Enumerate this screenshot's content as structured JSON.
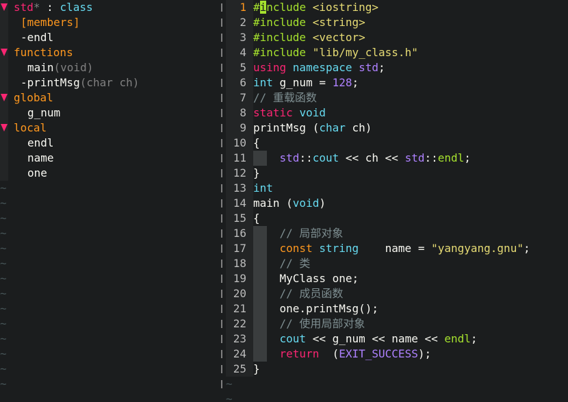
{
  "colors": {
    "background": "#1b1d1e",
    "accent_pink": "#f92672",
    "accent_green": "#a6e22e",
    "accent_orange": "#fd971f",
    "accent_purple": "#ae81ff",
    "accent_cyan": "#66d9ef",
    "comment_gray": "#7e8e91"
  },
  "tagbar": {
    "rows": [
      {
        "fold": true,
        "parts": [
          {
            "t": "std",
            "c": "c-red"
          },
          {
            "t": "* ",
            "c": "c-dim"
          },
          {
            "t": ": ",
            "c": "c-plain"
          },
          {
            "t": "class",
            "c": "c-type"
          }
        ]
      },
      {
        "fold": false,
        "indent": 1,
        "parts": [
          {
            "t": "[members]",
            "c": "c-orange"
          }
        ]
      },
      {
        "fold": false,
        "indent": 1,
        "parts": [
          {
            "t": "-endl",
            "c": "c-plain"
          }
        ]
      },
      {
        "fold": true,
        "parts": [
          {
            "t": "functions",
            "c": "c-orange"
          }
        ]
      },
      {
        "fold": false,
        "indent": 2,
        "parts": [
          {
            "t": "main",
            "c": "c-plain"
          },
          {
            "t": "(void)",
            "c": "c-dim"
          }
        ]
      },
      {
        "fold": false,
        "indent": 1,
        "parts": [
          {
            "t": "-printMsg",
            "c": "c-plain"
          },
          {
            "t": "(char ch)",
            "c": "c-dim"
          }
        ]
      },
      {
        "fold": true,
        "parts": [
          {
            "t": "global",
            "c": "c-orange"
          }
        ]
      },
      {
        "fold": false,
        "indent": 2,
        "parts": [
          {
            "t": "g_num",
            "c": "c-plain"
          }
        ]
      },
      {
        "fold": true,
        "parts": [
          {
            "t": "local",
            "c": "c-orange"
          }
        ]
      },
      {
        "fold": false,
        "indent": 2,
        "parts": [
          {
            "t": "endl",
            "c": "c-plain"
          }
        ]
      },
      {
        "fold": false,
        "indent": 2,
        "parts": [
          {
            "t": "name",
            "c": "c-plain"
          }
        ]
      },
      {
        "fold": false,
        "indent": 2,
        "parts": [
          {
            "t": "one",
            "c": "c-plain"
          }
        ]
      }
    ],
    "tilde_count": 14,
    "tilde_char": "~"
  },
  "editor": {
    "current_line": 1,
    "lines": [
      {
        "n": "1",
        "guide": false,
        "parts": [
          {
            "t": "#",
            "c": "c-pre"
          },
          {
            "t": "i",
            "c": "c-cursor"
          },
          {
            "t": "nclude ",
            "c": "c-pre"
          },
          {
            "t": "<iostring>",
            "c": "c-str"
          }
        ]
      },
      {
        "n": "2",
        "guide": false,
        "parts": [
          {
            "t": "#include ",
            "c": "c-pre"
          },
          {
            "t": "<string>",
            "c": "c-str"
          }
        ]
      },
      {
        "n": "3",
        "guide": false,
        "parts": [
          {
            "t": "#include ",
            "c": "c-pre"
          },
          {
            "t": "<vector>",
            "c": "c-str"
          }
        ]
      },
      {
        "n": "4",
        "guide": false,
        "parts": [
          {
            "t": "#include ",
            "c": "c-pre"
          },
          {
            "t": "\"lib/my_class.h\"",
            "c": "c-str"
          }
        ]
      },
      {
        "n": "5",
        "guide": false,
        "parts": [
          {
            "t": "using ",
            "c": "c-kw"
          },
          {
            "t": "namespace ",
            "c": "c-type"
          },
          {
            "t": "std",
            "c": "c-std"
          },
          {
            "t": ";",
            "c": "c-plain"
          }
        ]
      },
      {
        "n": "6",
        "guide": false,
        "parts": [
          {
            "t": "int ",
            "c": "c-type"
          },
          {
            "t": "g_num = ",
            "c": "c-plain"
          },
          {
            "t": "128",
            "c": "c-num"
          },
          {
            "t": ";",
            "c": "c-plain"
          }
        ]
      },
      {
        "n": "7",
        "guide": false,
        "parts": [
          {
            "t": "// 重载函数",
            "c": "c-com"
          }
        ]
      },
      {
        "n": "8",
        "guide": false,
        "parts": [
          {
            "t": "static ",
            "c": "c-kw"
          },
          {
            "t": "void",
            "c": "c-type"
          }
        ]
      },
      {
        "n": "9",
        "guide": false,
        "parts": [
          {
            "t": "printMsg (",
            "c": "c-plain"
          },
          {
            "t": "char ",
            "c": "c-type"
          },
          {
            "t": "ch)",
            "c": "c-plain"
          }
        ]
      },
      {
        "n": "10",
        "guide": false,
        "parts": [
          {
            "t": "{",
            "c": "c-plain"
          }
        ]
      },
      {
        "n": "11",
        "guide": true,
        "parts": [
          {
            "t": "    ",
            "c": "c-plain"
          },
          {
            "t": "std",
            "c": "c-std"
          },
          {
            "t": "::",
            "c": "c-plain"
          },
          {
            "t": "cout ",
            "c": "c-type"
          },
          {
            "t": "<< ch << ",
            "c": "c-plain"
          },
          {
            "t": "std",
            "c": "c-std"
          },
          {
            "t": "::",
            "c": "c-plain"
          },
          {
            "t": "endl",
            "c": "c-fn"
          },
          {
            "t": ";",
            "c": "c-plain"
          }
        ]
      },
      {
        "n": "12",
        "guide": false,
        "parts": [
          {
            "t": "}",
            "c": "c-plain"
          }
        ]
      },
      {
        "n": "13",
        "guide": false,
        "parts": [
          {
            "t": "int",
            "c": "c-type"
          }
        ]
      },
      {
        "n": "14",
        "guide": false,
        "parts": [
          {
            "t": "main (",
            "c": "c-plain"
          },
          {
            "t": "void",
            "c": "c-type"
          },
          {
            "t": ")",
            "c": "c-plain"
          }
        ]
      },
      {
        "n": "15",
        "guide": false,
        "parts": [
          {
            "t": "{",
            "c": "c-plain"
          }
        ]
      },
      {
        "n": "16",
        "guide": true,
        "parts": [
          {
            "t": "    ",
            "c": "c-plain"
          },
          {
            "t": "// 局部对象",
            "c": "c-com"
          }
        ]
      },
      {
        "n": "17",
        "guide": true,
        "parts": [
          {
            "t": "    ",
            "c": "c-plain"
          },
          {
            "t": "const ",
            "c": "c-orange"
          },
          {
            "t": "string",
            "c": "c-type"
          },
          {
            "t": "    name = ",
            "c": "c-plain"
          },
          {
            "t": "\"yangyang.gnu\"",
            "c": "c-str"
          },
          {
            "t": ";",
            "c": "c-plain"
          }
        ]
      },
      {
        "n": "18",
        "guide": true,
        "parts": [
          {
            "t": "    ",
            "c": "c-plain"
          },
          {
            "t": "// 类",
            "c": "c-com"
          }
        ]
      },
      {
        "n": "19",
        "guide": true,
        "parts": [
          {
            "t": "    ",
            "c": "c-plain"
          },
          {
            "t": "MyClass one;",
            "c": "c-plain"
          }
        ]
      },
      {
        "n": "20",
        "guide": true,
        "parts": [
          {
            "t": "    ",
            "c": "c-plain"
          },
          {
            "t": "// 成员函数",
            "c": "c-com"
          }
        ]
      },
      {
        "n": "21",
        "guide": true,
        "parts": [
          {
            "t": "    ",
            "c": "c-plain"
          },
          {
            "t": "one.printMsg();",
            "c": "c-plain"
          }
        ]
      },
      {
        "n": "22",
        "guide": true,
        "parts": [
          {
            "t": "    ",
            "c": "c-plain"
          },
          {
            "t": "// 使用局部对象",
            "c": "c-com"
          }
        ]
      },
      {
        "n": "23",
        "guide": true,
        "parts": [
          {
            "t": "    ",
            "c": "c-plain"
          },
          {
            "t": "cout ",
            "c": "c-type"
          },
          {
            "t": "<< g_num << name << ",
            "c": "c-plain"
          },
          {
            "t": "endl",
            "c": "c-fn"
          },
          {
            "t": ";",
            "c": "c-plain"
          }
        ]
      },
      {
        "n": "24",
        "guide": true,
        "parts": [
          {
            "t": "    ",
            "c": "c-plain"
          },
          {
            "t": "return  ",
            "c": "c-kw"
          },
          {
            "t": "(",
            "c": "c-plain"
          },
          {
            "t": "EXIT_SUCCESS",
            "c": "c-const"
          },
          {
            "t": ");",
            "c": "c-plain"
          }
        ]
      },
      {
        "n": "25",
        "guide": false,
        "parts": [
          {
            "t": "}",
            "c": "c-plain"
          }
        ]
      }
    ],
    "tilde_count": 2,
    "tilde_char": "~"
  }
}
